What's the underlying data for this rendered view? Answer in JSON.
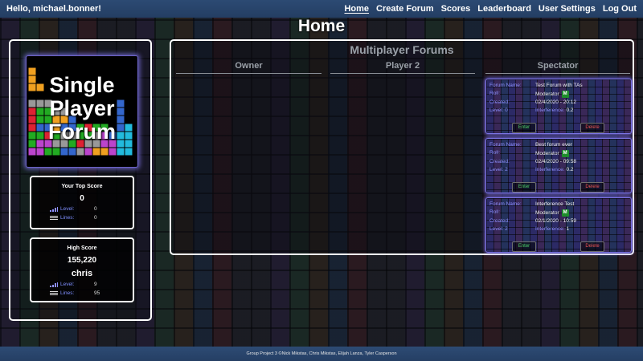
{
  "nav": {
    "greeting": "Hello, michael.bonner!",
    "links": [
      {
        "label": "Home",
        "active": true
      },
      {
        "label": "Create Forum",
        "active": false
      },
      {
        "label": "Scores",
        "active": false
      },
      {
        "label": "Leaderboard",
        "active": false
      },
      {
        "label": "User Settings",
        "active": false
      },
      {
        "label": "Log Out",
        "active": false
      }
    ]
  },
  "page": {
    "title": "Home"
  },
  "single_player": {
    "lines": [
      "Single",
      "Player",
      "Forum"
    ]
  },
  "top_score": {
    "title": "Your Top Score",
    "score": "0",
    "level_label": "Level:",
    "level": "0",
    "lines_label": "Lines:",
    "lines": "0"
  },
  "high_score": {
    "title": "High Score",
    "score": "155,220",
    "player": "chris",
    "level_label": "Level:",
    "level": "9",
    "lines_label": "Lines:",
    "lines": "95"
  },
  "multiplayer": {
    "title": "Multiplayer Forums",
    "columns": {
      "owner": "Owner",
      "player2": "Player 2",
      "spectator": "Spectator"
    },
    "forums": [
      {
        "name_label": "Forum Name:",
        "name": "Test Forum with TAs",
        "roll_label": "Roll:",
        "roll": "Moderator",
        "badge": "M",
        "created_label": "Created:",
        "created": "02/4/2020 - 20:12",
        "level_label": "Level: 0",
        "interference_label": "Interference:",
        "interference": "0.2",
        "enter_label": "Enter",
        "delete_label": "Delete"
      },
      {
        "name_label": "Forum Name:",
        "name": "Best forum ever",
        "roll_label": "Roll:",
        "roll": "Moderator",
        "badge": "M",
        "created_label": "Created:",
        "created": "02/4/2020 - 09:58",
        "level_label": "Level: 2",
        "interference_label": "Interference:",
        "interference": "0.2",
        "enter_label": "Enter",
        "delete_label": "Delete"
      },
      {
        "name_label": "Forum Name:",
        "name": "Interference Test",
        "roll_label": "Roll:",
        "roll": "Moderator",
        "badge": "M",
        "created_label": "Created:",
        "created": "02/1/2020 - 10:59",
        "level_label": "Level: 2",
        "interference_label": "Interference:",
        "interference": "1",
        "enter_label": "Enter",
        "delete_label": "Delete"
      }
    ]
  },
  "footer": {
    "text": "Group Project 3 ©Nick Mikstas, Chris Mikstas, Elijah Lanza, Tyler Casperson"
  },
  "colors": {
    "nav_bg": "#2c4a73",
    "label_purple": "#8e90ff",
    "enter_green": "#4fd36a",
    "delete_red": "#ee5555",
    "badge_green": "#1e8c2c"
  }
}
